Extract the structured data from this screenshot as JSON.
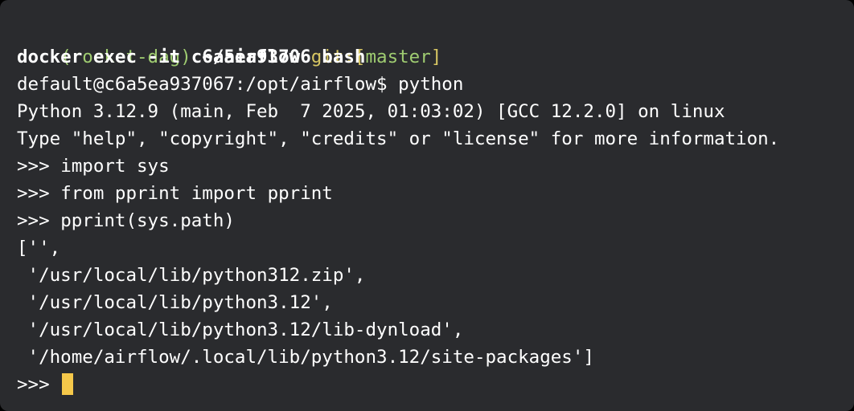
{
  "prompt": {
    "env": "(rocket-dag)",
    "cwd": "~/airflow",
    "git_label": "git:",
    "bracket_open": "[",
    "branch": "master",
    "bracket_close": "]"
  },
  "command": "docker exec -it c6a5ea93706 bash",
  "shell_prompt": "default@c6a5ea937067:/opt/airflow$",
  "shell_command": "python",
  "python_banner": [
    "Python 3.12.9 (main, Feb  7 2025, 01:03:02) [GCC 12.2.0] on linux",
    "Type \"help\", \"copyright\", \"credits\" or \"license\" for more information."
  ],
  "repl_lines": [
    {
      "prompt": ">>>",
      "code": "import sys"
    },
    {
      "prompt": ">>>",
      "code": "from pprint import pprint"
    },
    {
      "prompt": ">>>",
      "code": "pprint(sys.path)"
    }
  ],
  "output_lines": [
    "['',",
    " '/usr/local/lib/python312.zip',",
    " '/usr/local/lib/python3.12',",
    " '/usr/local/lib/python3.12/lib-dynload',",
    " '/home/airflow/.local/lib/python3.12/site-packages']"
  ],
  "final_prompt": ">>>",
  "colors": {
    "background": "#2a2b2e",
    "env": "#9fcc71",
    "git_label": "#d7c663",
    "cursor": "#f5c84a",
    "text": "#ffffff"
  }
}
